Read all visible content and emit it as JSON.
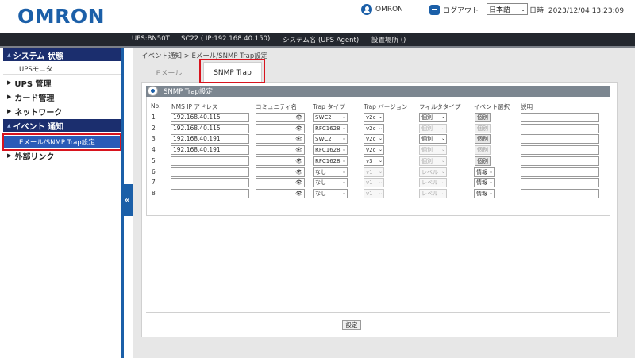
{
  "header": {
    "logo": "OMRON",
    "user_label": "OMRON",
    "logout_label": "ログアウト",
    "language_value": "日本語",
    "datetime": "日時: 2023/12/04 13:23:09"
  },
  "statusbar": {
    "ups": "UPS:BN50T",
    "card": "SC22 ( IP:192.168.40.150)",
    "system_name": "システム名 (UPS Agent)",
    "location": "設置場所 ()"
  },
  "sidebar": {
    "section_system": "システム 状態",
    "ups_monitor": "UPSモニタ",
    "ups_mgmt": "UPS 管理",
    "card_mgmt": "カード管理",
    "network": "ネットワーク",
    "section_event": "イベント 通知",
    "email_snmp": "Eメール/SNMP Trap設定",
    "external_links": "外部リンク"
  },
  "breadcrumb": "イベント通知 > Eメール/SNMP Trap設定",
  "tabs": {
    "email": "Eメール",
    "snmp": "SNMP Trap"
  },
  "panel_title": "SNMP Trap設定",
  "table": {
    "headers": {
      "no": "No.",
      "nms_ip": "NMS IP アドレス",
      "community": "コミュニティ名",
      "trap_type": "Trap タイプ",
      "trap_version": "Trap バージョン",
      "filter_type": "フィルタタイプ",
      "event_select": "イベント選択",
      "description": "説明"
    },
    "rows": [
      {
        "no": "1",
        "ip": "192.168.40.115",
        "type": "SWC2",
        "version": "v2c",
        "filter": "個別",
        "event": "個別"
      },
      {
        "no": "2",
        "ip": "192.168.40.115",
        "type": "RFC1628",
        "version": "v2c",
        "filter": "個別",
        "event": "個別"
      },
      {
        "no": "3",
        "ip": "192.168.40.191",
        "type": "SWC2",
        "version": "v2c",
        "filter": "個別",
        "event": "個別"
      },
      {
        "no": "4",
        "ip": "192.168.40.191",
        "type": "RFC1628",
        "version": "v2c",
        "filter": "個別",
        "event": "個別"
      },
      {
        "no": "5",
        "ip": "",
        "type": "RFC1628",
        "version": "v3",
        "filter": "個別",
        "event": "個別"
      },
      {
        "no": "6",
        "ip": "",
        "type": "なし",
        "version": "v1",
        "filter": "レベル",
        "event": "情報"
      },
      {
        "no": "7",
        "ip": "",
        "type": "なし",
        "version": "v1",
        "filter": "レベル",
        "event": "情報"
      },
      {
        "no": "8",
        "ip": "",
        "type": "なし",
        "version": "v1",
        "filter": "レベル",
        "event": "情報"
      }
    ]
  },
  "apply_label": "設定",
  "colors": {
    "brand": "#1b5fa8",
    "nav_dark": "#1b2e6e",
    "active_item": "#2a5bb8",
    "highlight": "#d8141e"
  }
}
